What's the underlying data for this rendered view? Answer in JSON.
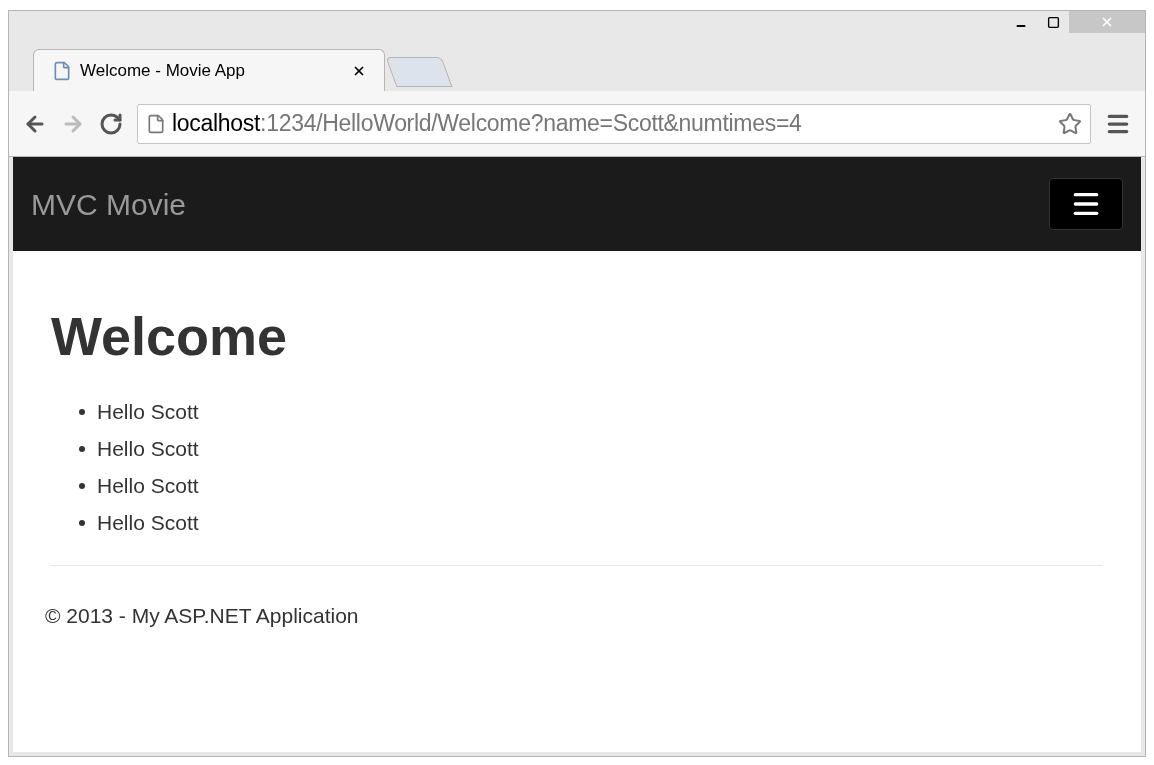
{
  "browser": {
    "tab": {
      "title": "Welcome - Movie App",
      "selected": true
    },
    "address": {
      "host": "localhost",
      "rest": ":1234/HelloWorld/Welcome?name=Scott&numtimes=4"
    }
  },
  "navbar": {
    "brand": "MVC Movie"
  },
  "heading": "Welcome",
  "items": [
    "Hello Scott",
    "Hello Scott",
    "Hello Scott",
    "Hello Scott"
  ],
  "footer": "© 2013 - My ASP.NET Application"
}
